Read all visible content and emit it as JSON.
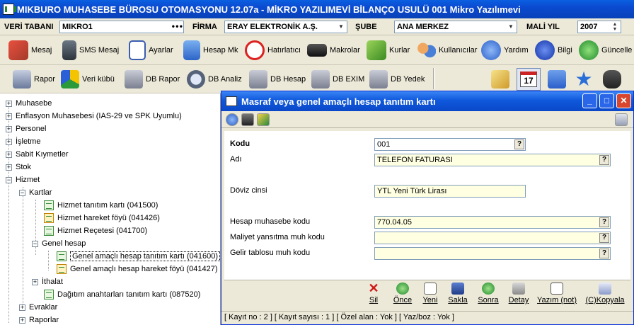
{
  "window": {
    "title": "MIKBURO MUHASEBE BÜROSU OTOMASYONU 12.07a - MİKRO YAZILIMEVİ BİLANÇO USULÜ 001 Mikro Yazılımevi"
  },
  "fields": {
    "veri_tabani_label": "VERİ TABANI",
    "veri_tabani_value": "MIKRO1",
    "firma_label": "FİRMA",
    "firma_value": "ERAY ELEKTRONİK A.Ş.",
    "sube_label": "ŞUBE",
    "sube_value": "ANA MERKEZ",
    "mali_yil_label": "MALİ YIL",
    "mali_yil_value": "2007"
  },
  "toolbar1": [
    {
      "label": "Mesaj",
      "icon": "mail-icon"
    },
    {
      "label": "SMS Mesaj",
      "icon": "phone-icon"
    },
    {
      "label": "Ayarlar",
      "icon": "checklist-icon"
    },
    {
      "label": "Hesap Mk",
      "icon": "calculator-icon"
    },
    {
      "label": "Hatırlatıcı",
      "icon": "alarm-clock-icon"
    },
    {
      "label": "Makrolar",
      "icon": "keyboard-icon"
    },
    {
      "label": "Kurlar",
      "icon": "money-icon"
    },
    {
      "label": "Kullanıcılar",
      "icon": "users-icon"
    },
    {
      "label": "Yardım",
      "icon": "help-icon"
    },
    {
      "label": "Bilgi",
      "icon": "info-icon"
    },
    {
      "label": "Güncelle",
      "icon": "update-icon"
    }
  ],
  "toolbar2": [
    {
      "label": "Rapor",
      "icon": "report-gear-icon"
    },
    {
      "label": "Veri kübü",
      "icon": "cube-icon"
    },
    {
      "label": "DB Rapor",
      "icon": "db-gear-icon"
    },
    {
      "label": "DB Analiz",
      "icon": "magnifier-icon"
    },
    {
      "label": "DB Hesap",
      "icon": "db-pencil-icon"
    },
    {
      "label": "DB EXIM",
      "icon": "db-exchange-icon"
    },
    {
      "label": "DB Yedek",
      "icon": "db-backup-icon"
    }
  ],
  "toolbar2_right_icons": [
    "edit-note-icon",
    "calendar-icon",
    "org-chart-icon",
    "star-icon",
    "binoculars-icon"
  ],
  "calendar_day": "17",
  "tree": {
    "muhasebe": "Muhasebe",
    "enflasyon": "Enflasyon Muhasebesi (IAS-29 ve SPK Uyumlu)",
    "personel": "Personel",
    "isletme": "İşletme",
    "sabit": "Sabit Kıymetler",
    "stok": "Stok",
    "hizmet": "Hizmet",
    "kartlar": "Kartlar",
    "hizmet_tanitim": "Hizmet tanıtım kartı (041500)",
    "hizmet_hareket": "Hizmet hareket föyü (041426)",
    "hizmet_recetesi": "Hizmet Reçetesi (041700)",
    "genel_hesap": "Genel hesap",
    "genel_tanitim": "Genel amaçlı hesap tanıtım kartı (041600)",
    "genel_hareket": "Genel amaçlı hesap hareket föyü (041427)",
    "ithalat": "İthalat",
    "dagitim": "Dağıtım anahtarları tanıtım kartı (087520)",
    "evraklar": "Evraklar",
    "raporlar": "Raporlar"
  },
  "dialog": {
    "title": "Masraf veya genel amaçlı hesap tanıtım kartı",
    "kodu_label": "Kodu",
    "kodu_value": "001",
    "adi_label": "Adı",
    "adi_value": "TELEFON FATURASI",
    "doviz_label": "Döviz cinsi",
    "doviz_value": "YTL Yeni Türk Lirası",
    "hesap_label": "Hesap muhasebe kodu",
    "hesap_value": "770.04.05",
    "maliyet_label": "Maliyet yansıtma muh kodu",
    "maliyet_value": "",
    "gelir_label": "Gelir tablosu muh kodu",
    "gelir_value": "",
    "q": "?"
  },
  "actions": [
    {
      "label": "Sil",
      "icon": "delete-icon"
    },
    {
      "label": "Önce",
      "icon": "previous-icon"
    },
    {
      "label": "Yeni",
      "icon": "new-icon"
    },
    {
      "label": "Sakla",
      "icon": "save-icon"
    },
    {
      "label": "Sonra",
      "icon": "next-icon"
    },
    {
      "label": "Detay",
      "icon": "detail-icon"
    },
    {
      "label": "Yazım (not)",
      "icon": "note-icon"
    },
    {
      "label": "(C)Kopyala",
      "icon": "copy-icon"
    }
  ],
  "status": "[ Kayıt no : 2 ] [ Kayıt sayısı : 1 ] [ Özel alan : Yok ] [ Yaz/boz : Yok ]",
  "colors": {
    "title_blue": "#0b4ad0",
    "field_yellow": "#ffffe1",
    "chrome": "#ece9d8"
  }
}
